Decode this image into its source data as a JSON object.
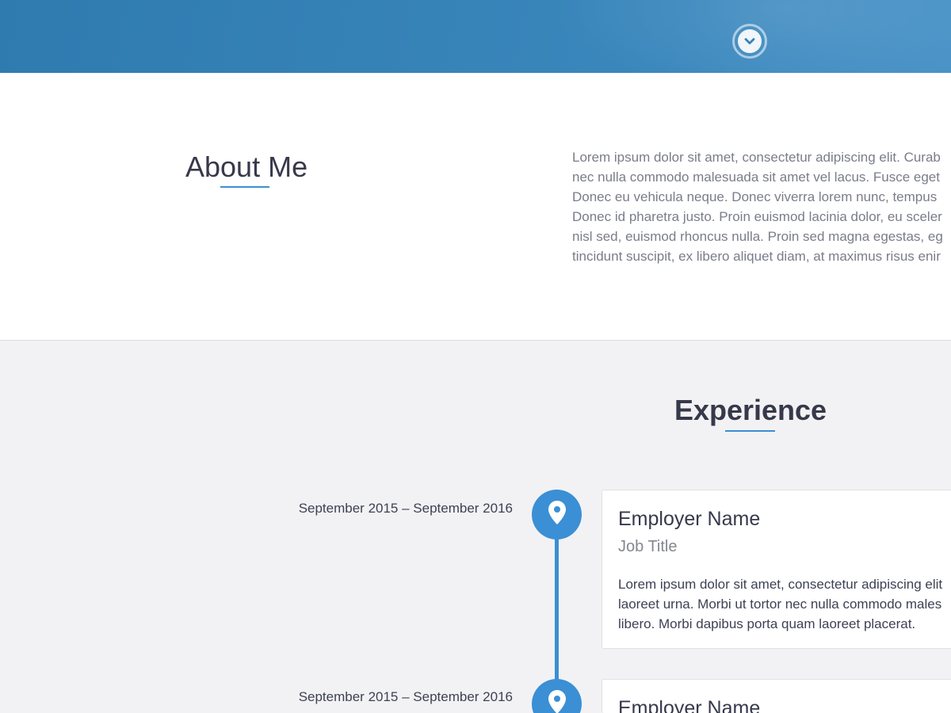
{
  "hero": {
    "scroll_icon": "chevron-down-icon"
  },
  "about": {
    "title": "About Me",
    "text_lines": [
      "Lorem ipsum dolor sit amet, consectetur adipiscing elit. Curab",
      "nec nulla commodo malesuada sit amet vel lacus. Fusce eget",
      "Donec eu vehicula neque. Donec viverra lorem nunc, tempus",
      "Donec id pharetra justo. Proin euismod lacinia dolor, eu sceler",
      "nisl sed, euismod rhoncus nulla. Proin sed magna egestas, eg",
      "tincidunt suscipit, ex libero aliquet diam, at maximus risus enir"
    ]
  },
  "experience": {
    "title": "Experience",
    "marker_icon": "map-pin-icon",
    "entries": [
      {
        "date": "September 2015 – September 2016",
        "employer": "Employer Name",
        "job_title": "Job Title",
        "description_lines": [
          "Lorem ipsum dolor sit amet, consectetur adipiscing elit",
          "laoreet urna. Morbi ut tortor nec nulla commodo males",
          "libero. Morbi dapibus porta quam laoreet placerat."
        ]
      },
      {
        "date": "September 2015 – September 2016",
        "employer": "Employer Name"
      }
    ]
  },
  "colors": {
    "accent": "#3b8fd4",
    "hero_blue": "#3683b8",
    "heading": "#37394b",
    "muted_text": "#7a7d89",
    "section_bg": "#f2f2f4"
  }
}
